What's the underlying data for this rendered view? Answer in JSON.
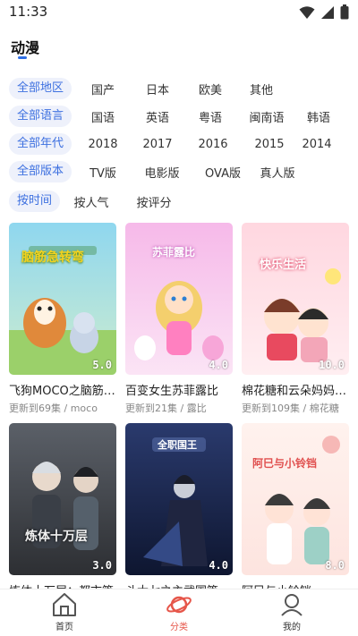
{
  "status_bar": {
    "time": "11:33"
  },
  "page_title": "动漫",
  "filters": [
    {
      "label": "全部地区",
      "options": [
        "国产",
        "日本",
        "欧美",
        "其他"
      ]
    },
    {
      "label": "全部语言",
      "options": [
        "国语",
        "英语",
        "粤语",
        "闽南语",
        "韩语"
      ]
    },
    {
      "label": "全部年代",
      "options": [
        "2018",
        "2017",
        "2016",
        "2015",
        "2014"
      ]
    },
    {
      "label": "全部版本",
      "options": [
        "TV版",
        "电影版",
        "OVA版",
        "真人版"
      ]
    },
    {
      "label": "按时间",
      "options": [
        "按人气",
        "按评分"
      ]
    }
  ],
  "cards": [
    {
      "title": "飞狗MOCO之脑筋急转弯",
      "subtitle": "更新到69集 / moco",
      "score": "5.0",
      "poster_text": "脑筋急转弯",
      "accent": "#7cc243"
    },
    {
      "title": "百变女生苏菲露比",
      "subtitle": "更新到21集 / 露比",
      "score": "4.0",
      "poster_text": "苏菲露比",
      "accent": "#d86fd8"
    },
    {
      "title": "棉花糖和云朵妈妈-快乐生活",
      "subtitle": "更新到109集 / 棉花糖",
      "score": "10.0",
      "poster_text": "快乐生活",
      "accent": "#ee4f78"
    },
    {
      "title": "炼体十万层：都市篇",
      "subtitle": "",
      "score": "3.0",
      "poster_text": "炼体十万层",
      "accent": "#8a8f97"
    },
    {
      "title": "斗大七之主武国篇",
      "subtitle": "",
      "score": "4.0",
      "poster_text": "全职国王",
      "accent": "#3a4e8a"
    },
    {
      "title": "阿巳与小铃铛",
      "subtitle": "",
      "score": "8.0",
      "poster_text": "阿巳与小铃铛",
      "accent": "#f2a0a0"
    }
  ],
  "nav": [
    {
      "label": "首页"
    },
    {
      "label": "分类"
    },
    {
      "label": "我的"
    }
  ]
}
